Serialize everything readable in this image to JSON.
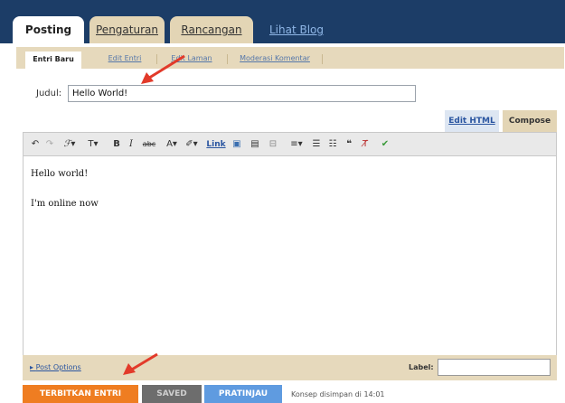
{
  "tabs": [
    {
      "label": "Posting",
      "active": true
    },
    {
      "label": "Pengaturan"
    },
    {
      "label": "Rancangan"
    },
    {
      "label": "Lihat Blog"
    }
  ],
  "subtabs": [
    "Entri Baru",
    "Edit Entri",
    "Edit Laman",
    "Moderasi Komentar"
  ],
  "title_field": {
    "label": "Judul:",
    "value": "Hello World!"
  },
  "modes": {
    "html": "Edit HTML",
    "compose": "Compose"
  },
  "toolbar": {
    "link": "Link"
  },
  "editor": {
    "lines": [
      "Hello world!",
      "I'm online now"
    ]
  },
  "footer": {
    "post_options": "Post Options",
    "label": "Label:"
  },
  "actions": {
    "publish": "TERBITKAN ENTRI",
    "saved": "SAVED",
    "preview": "PRATINJAU",
    "status": "Konsep disimpan di 14:01"
  },
  "colors": {
    "topbar": "#1c3d67",
    "tab_inactive": "#e3d5b5",
    "publish": "#ef7d21",
    "preview": "#5f9be0",
    "arrow": "#e23a2a"
  }
}
